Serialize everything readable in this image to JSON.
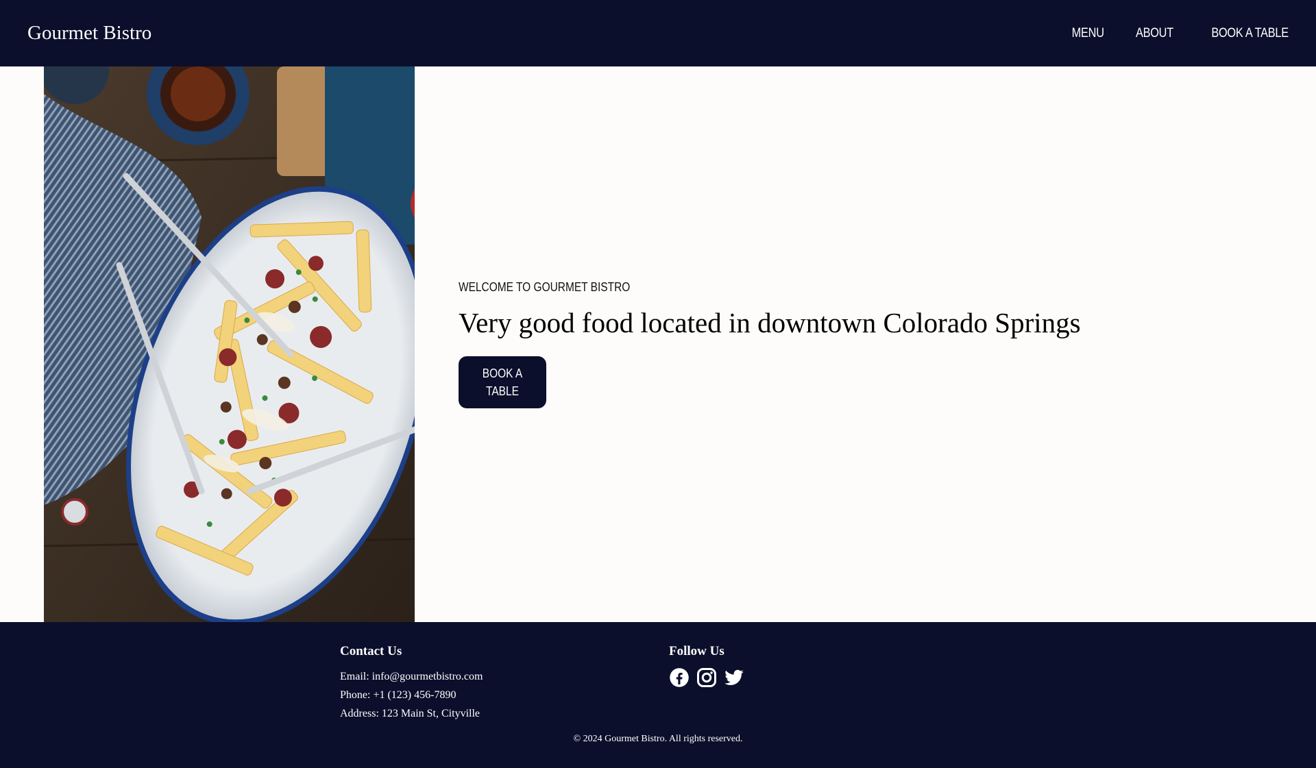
{
  "header": {
    "brand": "Gourmet Bistro",
    "nav": [
      {
        "label": "MENU"
      },
      {
        "label": "ABOUT"
      },
      {
        "label": "BOOK A TABLE"
      }
    ]
  },
  "hero": {
    "eyebrow": "WELCOME TO GOURMET BISTRO",
    "headline": "Very good food located in downtown Colorado Springs",
    "cta_label": "BOOK A TABLE"
  },
  "footer": {
    "contact": {
      "title": "Contact Us",
      "email": "Email: info@gourmetbistro.com",
      "phone": "Phone: +1 (123) 456-7890",
      "address": "Address: 123 Main St, Cityville"
    },
    "follow": {
      "title": "Follow Us",
      "icons": [
        "facebook-icon",
        "instagram-icon",
        "twitter-icon"
      ]
    },
    "copyright": "© 2024 Gourmet Bistro. All rights reserved."
  },
  "colors": {
    "navy": "#0b0f2b",
    "hero_bg": "#fdfcfa"
  }
}
